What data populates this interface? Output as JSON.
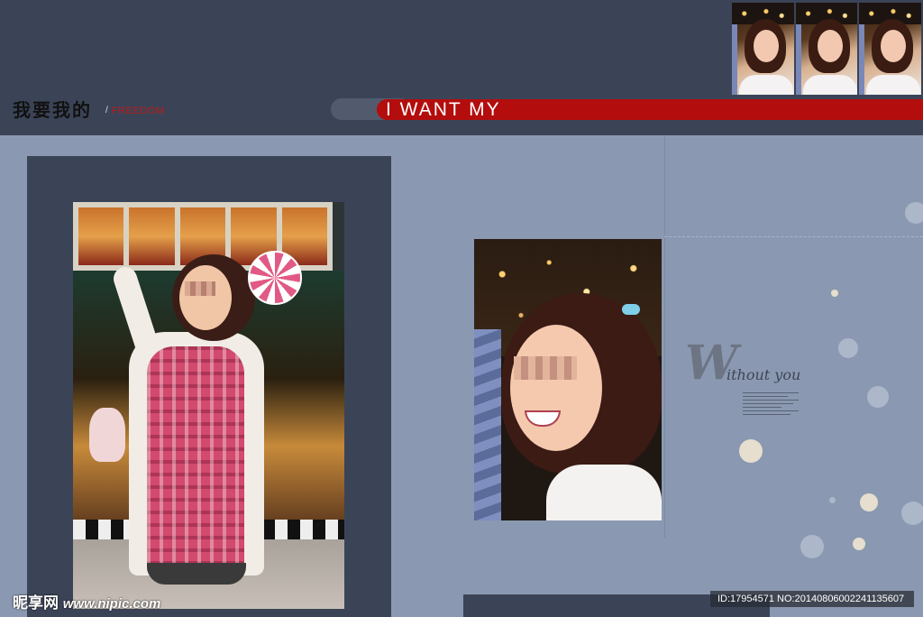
{
  "header": {
    "title_cn": "我要我的",
    "slash": "/",
    "freedom": "FREEDOM",
    "headline": "I WANT MY"
  },
  "decor_text": {
    "w_letter": "W",
    "w_rest": "ithout you"
  },
  "watermark": {
    "site_cn": "昵享网",
    "site_url": "www.nipic.com",
    "id_text": "ID:17954571 NO:20140806002241135607"
  },
  "colors": {
    "background": "#8a99b1",
    "band": "#3b4457",
    "accent_red": "#b30d0d"
  }
}
